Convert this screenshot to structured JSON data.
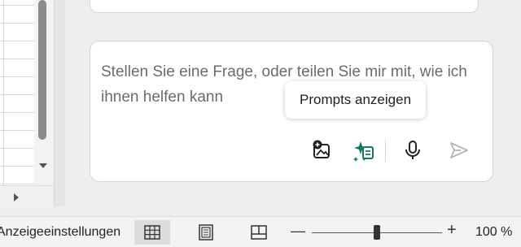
{
  "chat": {
    "input_placeholder": "Stellen Sie eine Frage, oder teilen Sie mir mit, wie ich ihnen helfen kann",
    "tooltip": "Prompts anzeigen",
    "tools": [
      {
        "name": "add-image-icon"
      },
      {
        "name": "prompts-icon"
      },
      {
        "name": "microphone-icon"
      },
      {
        "name": "send-icon"
      }
    ]
  },
  "statusbar": {
    "display_settings": "Anzeigeeinstellungen",
    "views": [
      "normal-view-icon",
      "page-layout-view-icon",
      "page-break-preview-icon"
    ],
    "zoom_value": "100 %",
    "zoom_level": 0.5
  },
  "colors": {
    "accent_green": "#0e7a5f",
    "text_muted": "#6b6b6b"
  }
}
